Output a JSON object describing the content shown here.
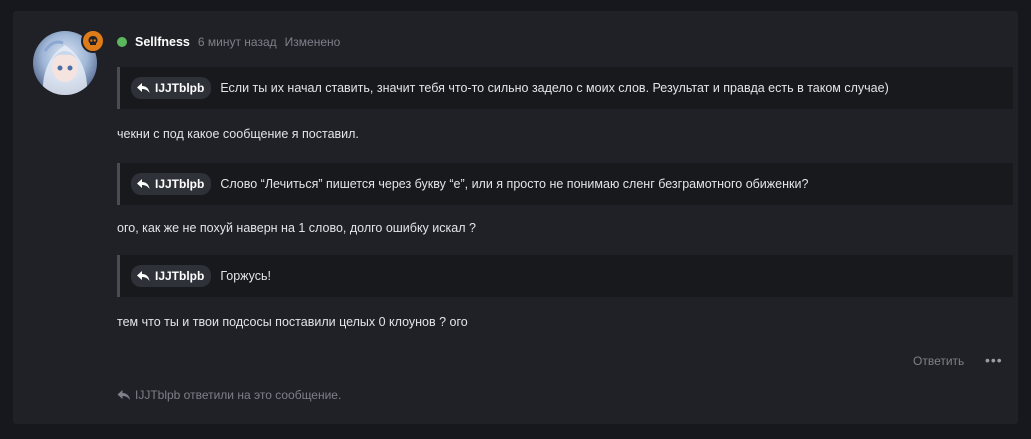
{
  "post": {
    "author": "Sellfness",
    "time": "6 минут назад",
    "edited": "Изменено",
    "status_color": "#5cb85c",
    "badge_color": "#e07b1a",
    "quotes": [
      {
        "user": "IJJTblpb",
        "text": "Если ты их начал ставить, значит тебя что-то сильно задело с моих слов. Результат и правда есть в таком случае)"
      },
      {
        "user": "IJJTblpb",
        "text": "Слово “Лечиться” пишется через букву “е”, или я просто не понимаю сленг безграмотного обиженки?"
      },
      {
        "user": "IJJTblpb",
        "text": "Горжусь!"
      }
    ],
    "paragraphs": [
      "чекни с под какое сообщение я поставил.",
      "ого, как же не похуй наверн на 1 слово, долго ошибку искал ?",
      "тем что ты и твои подсосы поставили целых 0 клоунов ? ого"
    ],
    "reply_label": "Ответить",
    "more_label": "•••",
    "replies_note": "IJJTblpb ответили на это сообщение."
  }
}
